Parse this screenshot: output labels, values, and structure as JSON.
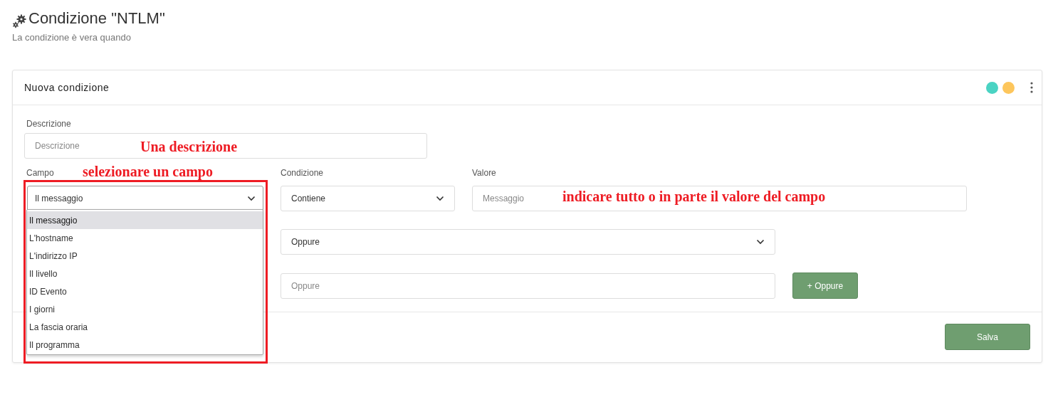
{
  "page": {
    "title": "Condizione \"NTLM\"",
    "subtitle": "La condizione è vera quando"
  },
  "card": {
    "title": "Nuova condizione",
    "dots": [
      {
        "color": "#4ad3c3"
      },
      {
        "color": "#fdc65c"
      }
    ]
  },
  "description": {
    "label": "Descrizione",
    "placeholder": "Descrizione"
  },
  "campo": {
    "label": "Campo",
    "value": "Il messaggio",
    "expanded": true,
    "options": [
      {
        "label": "Il messaggio",
        "selected": true
      },
      {
        "label": "L'hostname",
        "selected": false
      },
      {
        "label": "L'indirizzo IP",
        "selected": false
      },
      {
        "label": "Il livello",
        "selected": false
      },
      {
        "label": "ID Evento",
        "selected": false
      },
      {
        "label": "I giorni",
        "selected": false
      },
      {
        "label": "La fascia oraria",
        "selected": false
      },
      {
        "label": "Il programma",
        "selected": false
      }
    ]
  },
  "condizione": {
    "label": "Condizione",
    "value": "Contiene"
  },
  "valore": {
    "label": "Valore",
    "placeholder": "Messaggio"
  },
  "oppure_select": {
    "value": "Oppure"
  },
  "oppure_input": {
    "placeholder": "Oppure"
  },
  "add_button": "+ Oppure",
  "save_button": "Salva",
  "annotations": [
    {
      "kind": "description",
      "text": "Una descrizione"
    },
    {
      "kind": "campo",
      "text": "selezionare un campo"
    },
    {
      "kind": "valore",
      "text": "indicare tutto o in parte il valore del campo"
    }
  ]
}
